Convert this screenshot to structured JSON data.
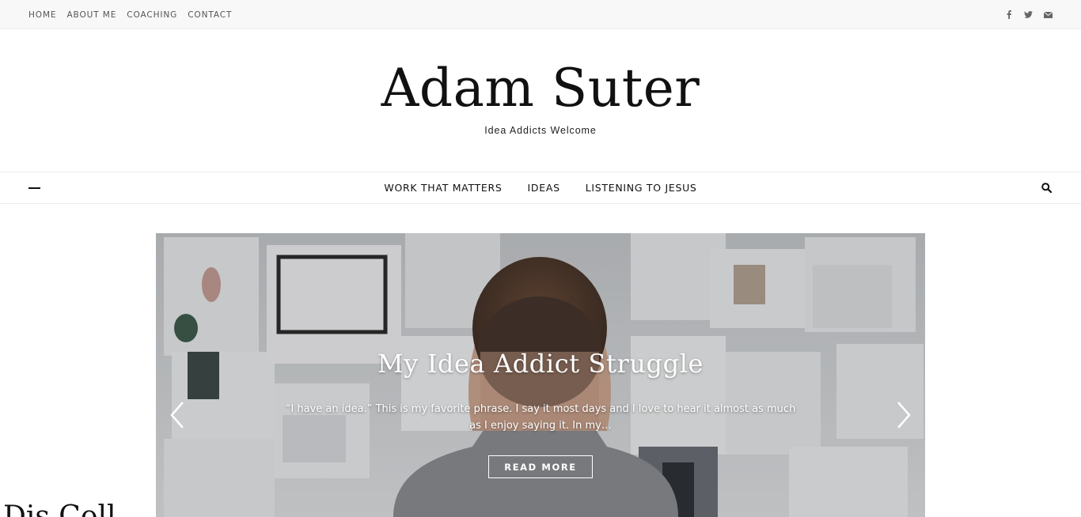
{
  "topbar": {
    "nav": [
      "HOME",
      "ABOUT ME",
      "COACHING",
      "CONTACT"
    ],
    "social_icons": [
      "facebook-icon",
      "twitter-icon",
      "envelope-icon"
    ]
  },
  "header": {
    "title": "Adam Suter",
    "tagline": "Idea Addicts Welcome"
  },
  "main_nav": {
    "menu_toggle_icon": "hamburger-icon",
    "items": [
      "WORK THAT MATTERS",
      "IDEAS",
      "LISTENING TO JESUS"
    ],
    "search_icon": "search-icon"
  },
  "slider": {
    "title": "My Idea Addict Struggle",
    "excerpt": "“I have an idea.” This is my favorite phrase. I say it most days and I love to hear it almost as much as I enjoy saying it. In my…",
    "button_label": "READ MORE",
    "prev_icon": "chevron-left-icon",
    "next_icon": "chevron-right-icon"
  },
  "below_slider": {
    "heading_partial": "Dis        Coll"
  },
  "colors": {
    "topbar_bg": "#f8f8f8",
    "text_dark": "#111111",
    "text_muted": "#555555",
    "overlay_text": "#ffffff"
  }
}
